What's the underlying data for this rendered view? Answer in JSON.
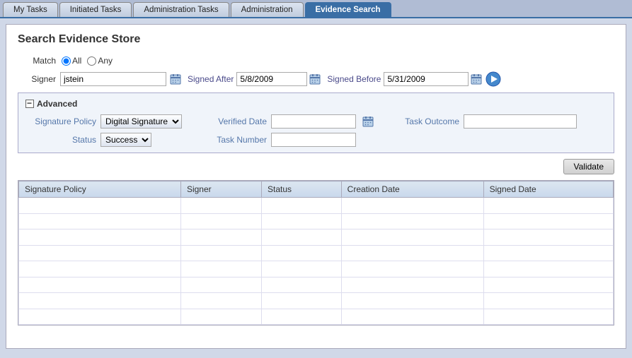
{
  "tabs": [
    {
      "id": "my-tasks",
      "label": "My Tasks",
      "active": false
    },
    {
      "id": "initiated-tasks",
      "label": "Initiated Tasks",
      "active": false
    },
    {
      "id": "administration-tasks",
      "label": "Administration Tasks",
      "active": false
    },
    {
      "id": "administration",
      "label": "Administration",
      "active": false
    },
    {
      "id": "evidence-search",
      "label": "Evidence Search",
      "active": true
    }
  ],
  "page": {
    "title": "Search Evidence Store",
    "match_label": "Match",
    "match_all_label": "All",
    "match_any_label": "Any",
    "signer_label": "Signer",
    "signer_value": "jstein",
    "signed_after_label": "Signed After",
    "signed_after_value": "5/8/2009",
    "signed_before_label": "Signed Before",
    "signed_before_value": "5/31/2009",
    "advanced_label": "Advanced",
    "signature_policy_label": "Signature Policy",
    "signature_policy_value": "Digital Signature",
    "status_label": "Status",
    "status_value": "Success",
    "verified_date_label": "Verified Date",
    "verified_date_value": "",
    "task_number_label": "Task Number",
    "task_number_value": "",
    "task_outcome_label": "Task Outcome",
    "task_outcome_value": "",
    "validate_btn": "Validate",
    "table_columns": [
      "Signature Policy",
      "Signer",
      "Status",
      "Creation Date",
      "Signed Date"
    ],
    "table_rows": []
  }
}
